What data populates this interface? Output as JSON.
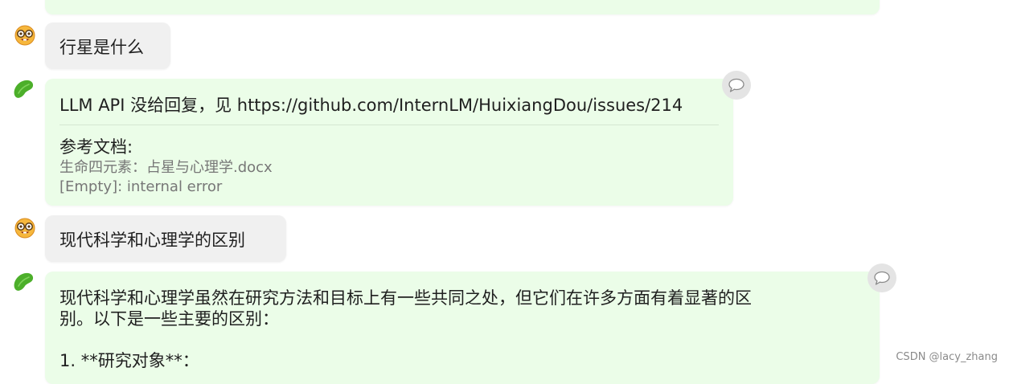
{
  "messages": [
    {
      "role": "user",
      "text": "行星是什么"
    },
    {
      "role": "assistant",
      "text": "LLM API 没给回复，见 https://github.com/InternLM/HuixiangDou/issues/214",
      "references_title": "参考文档:",
      "references": [
        "生命四元素：占星与心理学.docx",
        "[Empty]: internal error"
      ]
    },
    {
      "role": "user",
      "text": "现代科学和心理学的区别"
    },
    {
      "role": "assistant",
      "text_line1": "现代科学和心理学虽然在研究方法和目标上有一些共同之处，但它们在许多方面有着显著的区",
      "text_line2": "别。以下是一些主要的区别：",
      "text_line3": "1. **研究对象**："
    }
  ],
  "icons": {
    "user_avatar": "nerd-face-emoji-icon",
    "bot_avatar": "green-bean-icon",
    "copy": "speech-bubble-icon"
  },
  "colors": {
    "user_bubble": "#f0f0f0",
    "bot_bubble": "#ebfde8",
    "copy_button": "#e4e4e4"
  },
  "watermark": "CSDN @lacy_zhang"
}
